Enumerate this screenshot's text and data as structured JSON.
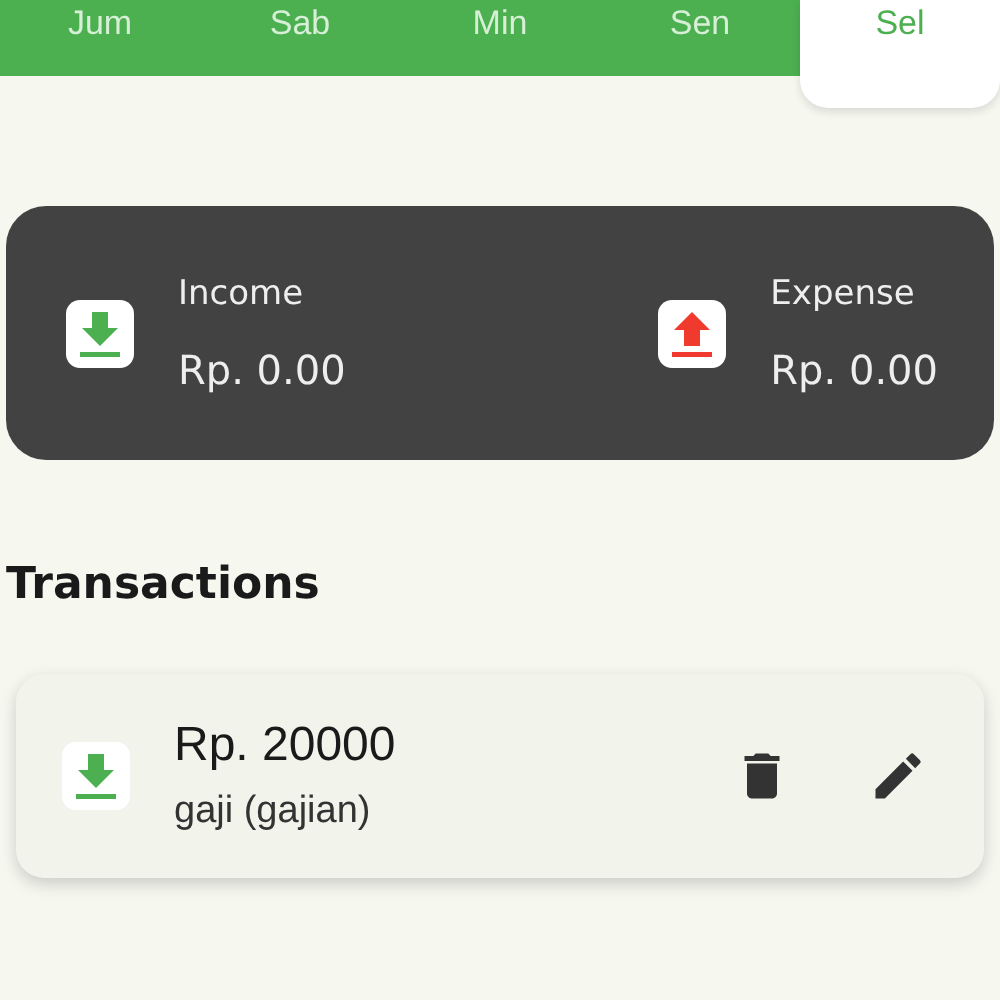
{
  "day_tabs": [
    {
      "label": "Jum",
      "selected": false
    },
    {
      "label": "Sab",
      "selected": false
    },
    {
      "label": "Min",
      "selected": false
    },
    {
      "label": "Sen",
      "selected": false
    },
    {
      "label": "Sel",
      "selected": true
    }
  ],
  "summary": [
    {
      "kind": "income",
      "label": "Income",
      "amount": "Rp. 0.00"
    },
    {
      "kind": "expense",
      "label": "Expense",
      "amount": "Rp. 0.00"
    }
  ],
  "transactions_heading": "Transactions",
  "transactions": [
    {
      "kind": "income",
      "amount": "Rp. 20000",
      "description": "gaji (gajian)"
    }
  ]
}
